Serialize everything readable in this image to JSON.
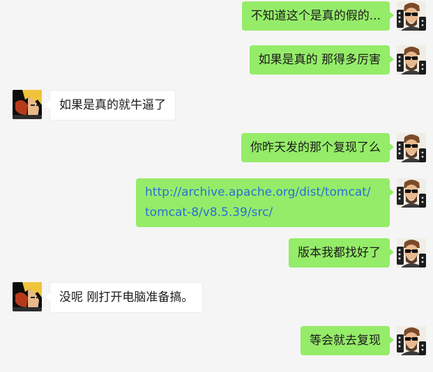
{
  "messages": [
    {
      "side": "right",
      "text": "不知道这个是真的假的..."
    },
    {
      "side": "right",
      "text": "如果是真的  那得多厉害"
    },
    {
      "side": "left",
      "text": "如果是真的就牛逼了"
    },
    {
      "side": "right",
      "text": "你昨天发的那个复现了么"
    },
    {
      "side": "right",
      "link_line1": "http://archive.apache.org/dist/tomcat/",
      "link_line2": "tomcat-8/v8.5.39/src/"
    },
    {
      "side": "right",
      "text": "版本我都找好了"
    },
    {
      "side": "left",
      "text": "没呢 刚打开电脑准备搞。"
    },
    {
      "side": "right",
      "text": "等会就去复现"
    }
  ],
  "colors": {
    "background": "#f5f5f5",
    "sent_bubble": "#95ec69",
    "received_bubble": "#ffffff",
    "link": "#2b6fd6"
  },
  "icons": {
    "sent_avatar": "glasses-man-avatar",
    "received_avatar": "anime-character-avatar"
  }
}
